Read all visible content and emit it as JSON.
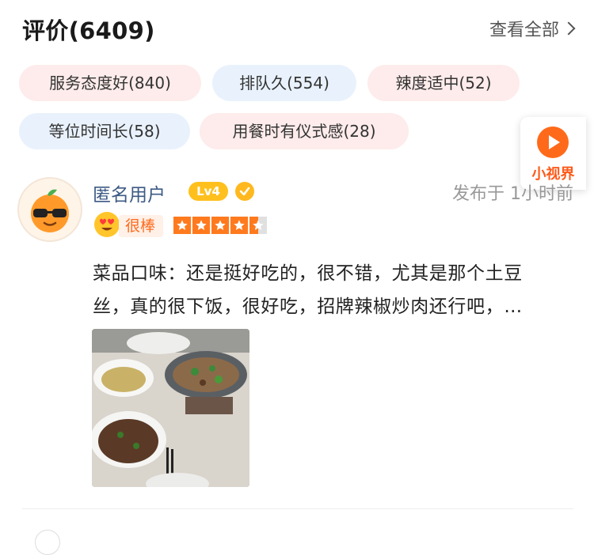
{
  "header": {
    "title": "评价(6409)",
    "see_all": "查看全部"
  },
  "tags": [
    {
      "label": "服务态度好(840)",
      "style": "pink"
    },
    {
      "label": "排队久(554)",
      "style": "blue"
    },
    {
      "label": "辣度适中(52)",
      "style": "pink"
    },
    {
      "label": "等位时间长(58)",
      "style": "blue"
    },
    {
      "label": "用餐时有仪式感(28)",
      "style": "pink"
    }
  ],
  "video_widget": {
    "label": "小视界",
    "icon": "play-icon",
    "color": "#ff6a1a"
  },
  "review": {
    "username": "匿名用户",
    "level": "Lv4",
    "publish_time": "发布于 1小时前",
    "rating_word": "很棒",
    "rating_stars": 4.5,
    "rating_max": 5,
    "text_line1": "菜品口味：还是挺好吃的，很不错，尤其是那个土豆",
    "text_line2": "丝，真的很下饭，很好吃，招牌辣椒炒肉还行吧，…",
    "photo_count": 1
  },
  "colors": {
    "accent": "#ff6a1a",
    "tag_pink": "#fdeceb",
    "tag_blue": "#e9f2fc",
    "username": "#3d5a84",
    "level_badge": "#ffc01e"
  }
}
